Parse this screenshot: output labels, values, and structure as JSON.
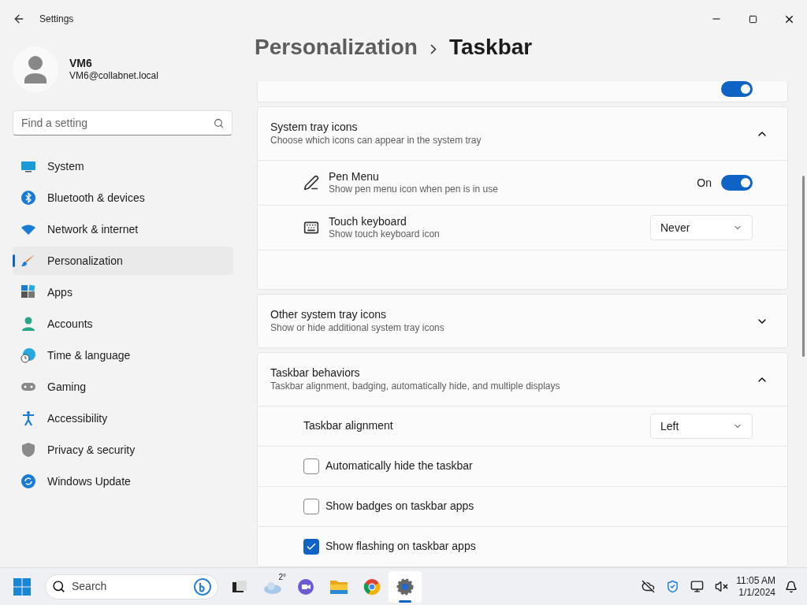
{
  "window": {
    "title": "Settings"
  },
  "user": {
    "name": "VM6",
    "email": "VM6@collabnet.local"
  },
  "search": {
    "placeholder": "Find a setting"
  },
  "nav": [
    {
      "label": "System",
      "selected": false
    },
    {
      "label": "Bluetooth & devices",
      "selected": false
    },
    {
      "label": "Network & internet",
      "selected": false
    },
    {
      "label": "Personalization",
      "selected": true
    },
    {
      "label": "Apps",
      "selected": false
    },
    {
      "label": "Accounts",
      "selected": false
    },
    {
      "label": "Time & language",
      "selected": false
    },
    {
      "label": "Gaming",
      "selected": false
    },
    {
      "label": "Accessibility",
      "selected": false
    },
    {
      "label": "Privacy & security",
      "selected": false
    },
    {
      "label": "Windows Update",
      "selected": false
    }
  ],
  "breadcrumb": {
    "parent": "Personalization",
    "current": "Taskbar"
  },
  "partial_row": {
    "on": true
  },
  "sections": [
    {
      "title": "System tray icons",
      "subtitle": "Choose which icons can appear in the system tray",
      "expanded": true,
      "items": [
        {
          "kind": "toggle",
          "label": "Pen Menu",
          "description": "Show pen menu icon when pen is in use",
          "state_label": "On",
          "on": true
        },
        {
          "kind": "dropdown",
          "label": "Touch keyboard",
          "description": "Show touch keyboard icon",
          "value": "Never"
        }
      ]
    },
    {
      "title": "Other system tray icons",
      "subtitle": "Show or hide additional system tray icons",
      "expanded": false
    },
    {
      "title": "Taskbar behaviors",
      "subtitle": "Taskbar alignment, badging, automatically hide, and multiple displays",
      "expanded": true,
      "items": [
        {
          "kind": "dropdown",
          "label": "Taskbar alignment",
          "value": "Left"
        },
        {
          "kind": "checkbox",
          "label": "Automatically hide the taskbar",
          "checked": false
        },
        {
          "kind": "checkbox",
          "label": "Show badges on taskbar apps",
          "checked": false
        },
        {
          "kind": "checkbox",
          "label": "Show flashing on taskbar apps",
          "checked": true
        }
      ]
    }
  ],
  "taskbar": {
    "search_placeholder": "Search",
    "temperature": "2°",
    "apps": [
      {
        "selected": false
      },
      {
        "selected": false
      },
      {
        "selected": false
      },
      {
        "selected": false
      },
      {
        "selected": false
      },
      {
        "selected": true
      }
    ],
    "time": "11:05 AM",
    "date": "1/1/2024"
  }
}
